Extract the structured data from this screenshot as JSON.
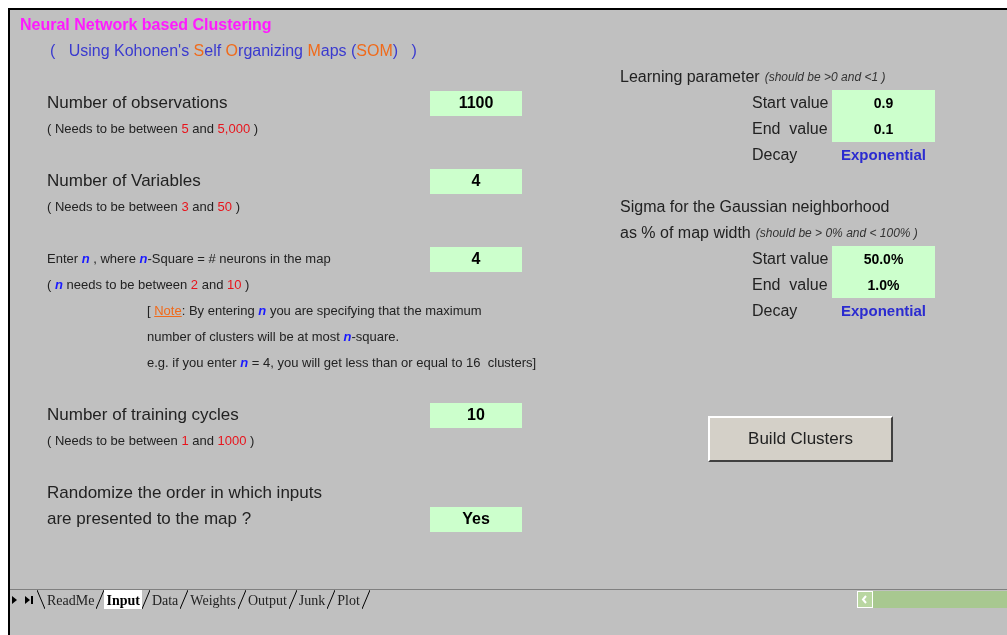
{
  "title": "Neural Network based Clustering",
  "subtitle": [
    {
      "text": "(   Using Kohonen's ",
      "kind": "plain"
    },
    {
      "text": "S",
      "kind": "accent"
    },
    {
      "text": "elf ",
      "kind": "plain"
    },
    {
      "text": "O",
      "kind": "accent"
    },
    {
      "text": "rganizing ",
      "kind": "plain"
    },
    {
      "text": "M",
      "kind": "accent"
    },
    {
      "text": "aps (",
      "kind": "plain"
    },
    {
      "text": "SOM",
      "kind": "accent"
    },
    {
      "text": ")   )",
      "kind": "plain"
    }
  ],
  "inputs": [
    {
      "kind": "large",
      "label": [
        [
          {
            "text": "Number of observations",
            "kind": "plain"
          }
        ]
      ],
      "value": "1100",
      "hint": [
        {
          "text": "( Needs to be between ",
          "kind": "plain"
        },
        {
          "text": "5",
          "kind": "limit"
        },
        {
          "text": " and ",
          "kind": "plain"
        },
        {
          "text": "5,000",
          "kind": "limit"
        },
        {
          "text": " )",
          "kind": "plain"
        }
      ]
    },
    {
      "kind": "large",
      "label": [
        [
          {
            "text": "Number of Variables",
            "kind": "plain"
          }
        ]
      ],
      "value": "4",
      "hint": [
        {
          "text": "( Needs to be between ",
          "kind": "plain"
        },
        {
          "text": "3",
          "kind": "limit"
        },
        {
          "text": " and ",
          "kind": "plain"
        },
        {
          "text": "50",
          "kind": "limit"
        },
        {
          "text": " )",
          "kind": "plain"
        }
      ]
    },
    {
      "kind": "small",
      "label": [
        [
          {
            "text": "Enter ",
            "kind": "plain"
          },
          {
            "text": "n",
            "kind": "var"
          },
          {
            "text": " , where ",
            "kind": "plain"
          },
          {
            "text": "n",
            "kind": "var"
          },
          {
            "text": "-Square = # neurons in the map",
            "kind": "plain"
          }
        ]
      ],
      "value": "4",
      "hint": [
        {
          "text": "( ",
          "kind": "plain"
        },
        {
          "text": "n",
          "kind": "var"
        },
        {
          "text": " needs to be between ",
          "kind": "plain"
        },
        {
          "text": "2",
          "kind": "limit"
        },
        {
          "text": " and ",
          "kind": "plain"
        },
        {
          "text": "10",
          "kind": "limit"
        },
        {
          "text": " )",
          "kind": "plain"
        }
      ],
      "note": [
        [
          {
            "text": "[ ",
            "kind": "plain"
          },
          {
            "text": "Note",
            "kind": "note"
          },
          {
            "text": ": By entering ",
            "kind": "plain"
          },
          {
            "text": "n",
            "kind": "var"
          },
          {
            "text": " you are specifying that the maximum",
            "kind": "plain"
          }
        ],
        [
          {
            "text": "number of clusters will be at most ",
            "kind": "plain"
          },
          {
            "text": "n",
            "kind": "var"
          },
          {
            "text": "-square.",
            "kind": "plain"
          }
        ],
        [
          {
            "text": "e.g. if you enter ",
            "kind": "plain"
          },
          {
            "text": "n",
            "kind": "var"
          },
          {
            "text": " = 4, you will get less than or equal to 16  clusters]",
            "kind": "plain"
          }
        ]
      ]
    },
    {
      "kind": "large",
      "label": [
        [
          {
            "text": "Number of training cycles",
            "kind": "plain"
          }
        ]
      ],
      "value": "10",
      "hint": [
        {
          "text": "( Needs to be between ",
          "kind": "plain"
        },
        {
          "text": "1",
          "kind": "limit"
        },
        {
          "text": " and ",
          "kind": "plain"
        },
        {
          "text": "1000",
          "kind": "limit"
        },
        {
          "text": " )",
          "kind": "plain"
        }
      ]
    },
    {
      "kind": "large",
      "label": [
        [
          {
            "text": "Randomize the order in which inputs",
            "kind": "plain"
          }
        ],
        [
          {
            "text": "are presented to the map ?",
            "kind": "plain"
          }
        ]
      ],
      "value": "Yes"
    }
  ],
  "parameters": [
    {
      "heading": [
        "Learning parameter"
      ],
      "hint": "(should be >0 and <1 )",
      "start_label": "Start value",
      "start": "0.9",
      "end_label": "End  value",
      "end": "0.1",
      "decay_label": "Decay",
      "decay": "Exponential"
    },
    {
      "heading": [
        "Sigma for the Gaussian neighborhood",
        "as % of map width"
      ],
      "hint": "(should be > 0% and < 100% )",
      "start_label": "Start value",
      "start": "50.0%",
      "end_label": "End  value",
      "end": "1.0%",
      "decay_label": "Decay",
      "decay": "Exponential"
    }
  ],
  "build_button": "Build Clusters",
  "sheet_tabs": [
    {
      "label": "ReadMe",
      "selected": false
    },
    {
      "label": "Input",
      "selected": true
    },
    {
      "label": "Data",
      "selected": false
    },
    {
      "label": "Weights",
      "selected": false
    },
    {
      "label": "Output",
      "selected": false
    },
    {
      "label": "Junk",
      "selected": false
    },
    {
      "label": "Plot",
      "selected": false
    }
  ]
}
